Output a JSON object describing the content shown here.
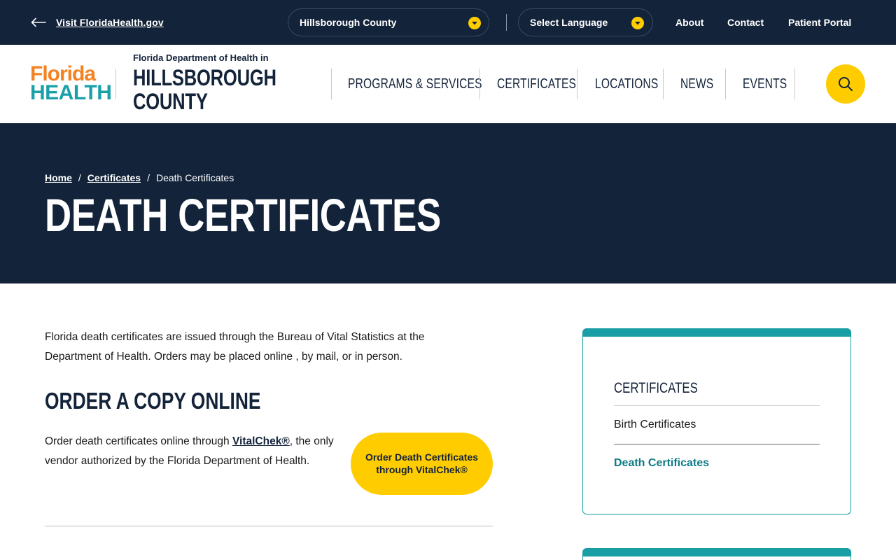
{
  "topbar": {
    "back_link": "Visit FloridaHealth.gov",
    "county_select": "Hillsborough County",
    "language_select": "Select Language",
    "links": [
      "About",
      "Contact",
      "Patient Portal"
    ]
  },
  "header": {
    "logo_line1": "Florida",
    "logo_line2": "HEALTH",
    "dept_small": "Florida Department of Health in",
    "dept_big_line1": "HILLSBOROUGH",
    "dept_big_line2": "COUNTY",
    "nav": [
      "PROGRAMS & SERVICES",
      "CERTIFICATES",
      "LOCATIONS",
      "NEWS",
      "EVENTS"
    ],
    "search_icon": "search-icon"
  },
  "hero": {
    "breadcrumb": [
      "Home",
      "Certificates",
      "Death Certificates"
    ],
    "breadcrumb_sep": "/",
    "title": "DEATH CERTIFICATES"
  },
  "main": {
    "intro": "Florida death certificates are issued through the Bureau of Vital Statistics at the Department of Health. Orders may be placed online , by mail, or in person.",
    "section_title": "ORDER A COPY ONLINE",
    "order_text_before": "Order death certificates online through ",
    "order_link": "VitalChek®",
    "order_text_after": ", the only vendor authorized by the Florida Department of Health.",
    "cta_label": "Order Death Certificates through VitalChek®"
  },
  "sidebar": {
    "title": "CERTIFICATES",
    "items": [
      {
        "label": "Birth Certificates",
        "active": false
      },
      {
        "label": "Death Certificates",
        "active": true
      }
    ]
  },
  "colors": {
    "navy": "#13233a",
    "yellow": "#ffcc00",
    "teal": "#1a9ea6",
    "orange": "#f58220"
  }
}
